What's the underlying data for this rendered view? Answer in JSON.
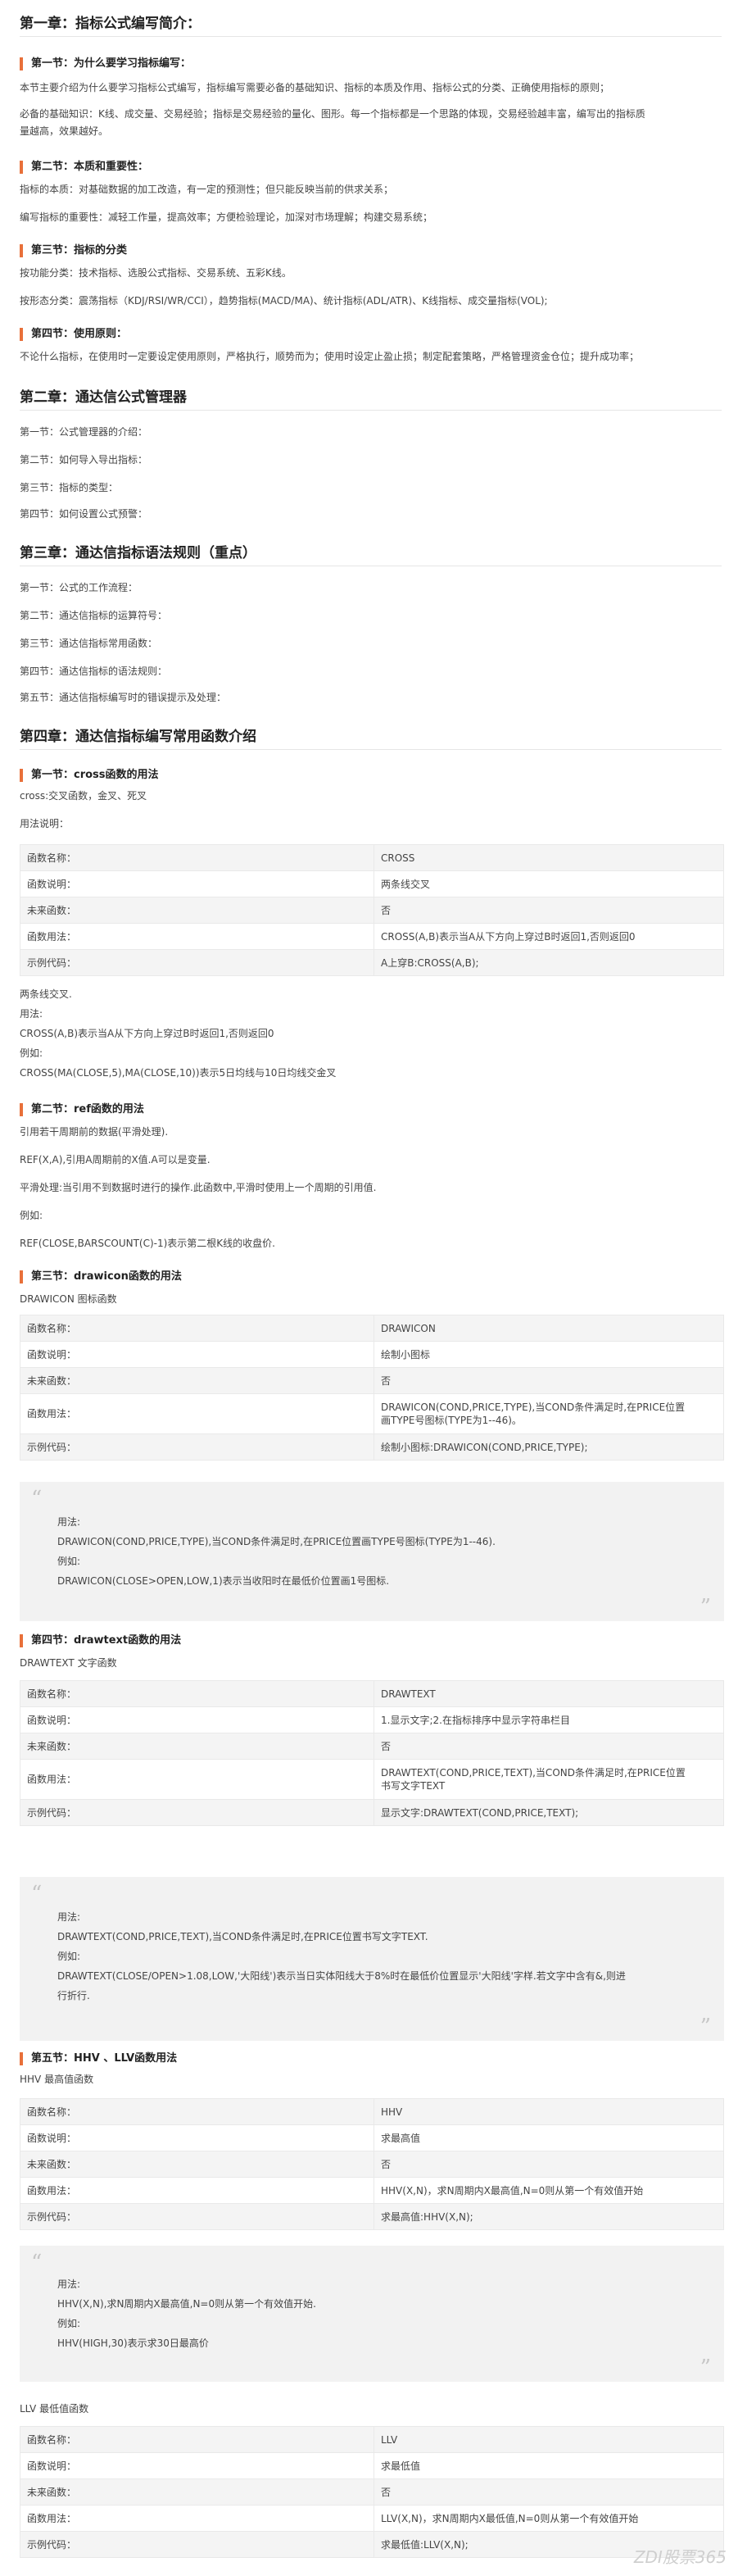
{
  "ch1": {
    "title": "第一章：指标公式编写简介：",
    "s1": {
      "title": "第一节：为什么要学习指标编写：",
      "p1": "本节主要介绍为什么要学习指标公式编写，指标编写需要必备的基础知识、指标的本质及作用、指标公式的分类、正确使用指标的原则；",
      "p2a": "必备的基础知识：K线、成交量、交易经验；指标是交易经验的量化、图形。每一个指标都是一个思路的体现，交易经验越丰富，编写出的指标质",
      "p2b": "量越高，效果越好。"
    },
    "s2": {
      "title": "第二节：本质和重要性：",
      "p1": "指标的本质：对基础数据的加工改造，有一定的预测性；但只能反映当前的供求关系；",
      "p2": "编写指标的重要性：减轻工作量，提高效率；方便检验理论，加深对市场理解；构建交易系统；"
    },
    "s3": {
      "title": "第三节：指标的分类",
      "p1": "按功能分类：技术指标、选股公式指标、交易系统、五彩K线。",
      "p2": "按形态分类：震荡指标（KDJ/RSI/WR/CCI），趋势指标(MACD/MA)、统计指标(ADL/ATR)、K线指标、成交量指标(VOL);"
    },
    "s4": {
      "title": "第四节：使用原则：",
      "p1": "不论什么指标，在使用时一定要设定使用原则，严格执行，顺势而为；使用时设定止盈止损；制定配套策略，严格管理资金仓位；提升成功率；"
    }
  },
  "ch2": {
    "title": "第二章：通达信公式管理器",
    "l1": "第一节：公式管理器的介绍：",
    "l2": "第二节：如何导入导出指标：",
    "l3": "第三节：指标的类型：",
    "l4": "第四节：如何设置公式预警："
  },
  "ch3": {
    "title": "第三章：通达信指标语法规则（重点）",
    "l1": "第一节：公式的工作流程：",
    "l2": "第二节：通达信指标的运算符号：",
    "l3": "第三节：通达信指标常用函数：",
    "l4": "第四节：通达信指标的语法规则：",
    "l5": "第五节：通达信指标编写时的错误提示及处理："
  },
  "ch4": {
    "title": "第四章：通达信指标编写常用函数介绍",
    "s1": {
      "title": "第一节：cross函数的用法",
      "intro": "cross:交叉函数，金叉、死叉",
      "usage_label": "用法说明：",
      "table": [
        [
          "函数名称：",
          "CROSS"
        ],
        [
          "函数说明：",
          "两条线交叉"
        ],
        [
          "未来函数：",
          "否"
        ],
        [
          "函数用法：",
          "CROSS(A,B)表示当A从下方向上穿过B时返回1,否则返回0"
        ],
        [
          "示例代码：",
          "A上穿B:CROSS(A,B);"
        ]
      ],
      "after": [
        "两条线交叉.",
        "用法:",
        "CROSS(A,B)表示当A从下方向上穿过B时返回1,否则返回0",
        "例如:",
        "CROSS(MA(CLOSE,5),MA(CLOSE,10))表示5日均线与10日均线交金叉"
      ]
    },
    "s2": {
      "title": "第二节：ref函数的用法",
      "lines": [
        "引用若干周期前的数据(平滑处理).",
        "REF(X,A),引用A周期前的X值.A可以是变量.",
        "平滑处理:当引用不到数据时进行的操作.此函数中,平滑时使用上一个周期的引用值.",
        "例如:",
        "REF(CLOSE,BARSCOUNT(C)-1)表示第二根K线的收盘价."
      ]
    },
    "s3": {
      "title": "第三节：drawicon函数的用法",
      "intro": "DRAWICON 图标函数",
      "table": [
        [
          "函数名称：",
          "DRAWICON"
        ],
        [
          "函数说明：",
          "绘制小图标"
        ],
        [
          "未来函数：",
          "否"
        ],
        [
          "函数用法：",
          "DRAWICON(COND,PRICE,TYPE),当COND条件满足时,在PRICE位置",
          "画TYPE号图标(TYPE为1--46)。"
        ],
        [
          "示例代码：",
          "绘制小图标:DRAWICON(COND,PRICE,TYPE);"
        ]
      ],
      "quote": [
        "用法:",
        "DRAWICON(COND,PRICE,TYPE),当COND条件满足时,在PRICE位置画TYPE号图标(TYPE为1--46).",
        "例如:",
        "DRAWICON(CLOSE>OPEN,LOW,1)表示当收阳时在最低价位置画1号图标."
      ]
    },
    "s4": {
      "title": "第四节：drawtext函数的用法",
      "intro": "DRAWTEXT 文字函数",
      "table": [
        [
          "函数名称：",
          "DRAWTEXT"
        ],
        [
          "函数说明：",
          "1.显示文字;2.在指标排序中显示字符串栏目"
        ],
        [
          "未来函数：",
          "否"
        ],
        [
          "函数用法：",
          "DRAWTEXT(COND,PRICE,TEXT),当COND条件满足时,在PRICE位置",
          "书写文字TEXT"
        ],
        [
          "示例代码：",
          "显示文字:DRAWTEXT(COND,PRICE,TEXT);"
        ]
      ],
      "quote": [
        "用法:",
        "DRAWTEXT(COND,PRICE,TEXT),当COND条件满足时,在PRICE位置书写文字TEXT.",
        "例如:",
        "DRAWTEXT(CLOSE/OPEN>1.08,LOW,'大阳线')表示当日实体阳线大于8%时在最低价位置显示'大阳线'字样.若文字中含有&,则进",
        "行折行."
      ]
    },
    "s5": {
      "title": "第五节：HHV 、LLV函数用法",
      "hhv_intro": "HHV 最高值函数",
      "hhv_table": [
        [
          "函数名称：",
          "HHV"
        ],
        [
          "函数说明：",
          "求最高值"
        ],
        [
          "未来函数：",
          "否"
        ],
        [
          "函数用法：",
          "HHV(X,N)，求N周期内X最高值,N=0则从第一个有效值开始"
        ],
        [
          "示例代码：",
          "求最高值:HHV(X,N);"
        ]
      ],
      "hhv_quote": [
        "用法:",
        "HHV(X,N),求N周期内X最高值,N=0则从第一个有效值开始.",
        "例如:",
        "HHV(HIGH,30)表示求30日最高价"
      ],
      "llv_intro": "LLV 最低值函数",
      "llv_table": [
        [
          "函数名称：",
          "LLV"
        ],
        [
          "函数说明：",
          "求最低值"
        ],
        [
          "未来函数：",
          "否"
        ],
        [
          "函数用法：",
          "LLV(X,N)，求N周期内X最低值,N=0则从第一个有效值开始"
        ],
        [
          "示例代码：",
          "求最低值:LLV(X,N);"
        ]
      ]
    }
  },
  "watermark": "ZDI股票365"
}
